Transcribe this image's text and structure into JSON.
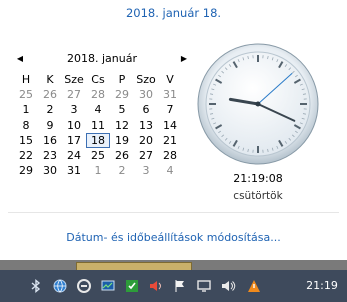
{
  "header": {
    "full_date": "2018. január 18."
  },
  "calendar": {
    "month_title": "2018. január",
    "prev_arrow": "◀",
    "next_arrow": "▶",
    "weekdays": [
      "H",
      "K",
      "Sze",
      "Cs",
      "P",
      "Szo",
      "V"
    ],
    "days": [
      {
        "d": "25",
        "other": true
      },
      {
        "d": "26",
        "other": true
      },
      {
        "d": "27",
        "other": true
      },
      {
        "d": "28",
        "other": true
      },
      {
        "d": "29",
        "other": true
      },
      {
        "d": "30",
        "other": true
      },
      {
        "d": "31",
        "other": true
      },
      {
        "d": "1"
      },
      {
        "d": "2"
      },
      {
        "d": "3"
      },
      {
        "d": "4"
      },
      {
        "d": "5"
      },
      {
        "d": "6"
      },
      {
        "d": "7"
      },
      {
        "d": "8"
      },
      {
        "d": "9"
      },
      {
        "d": "10"
      },
      {
        "d": "11"
      },
      {
        "d": "12"
      },
      {
        "d": "13"
      },
      {
        "d": "14"
      },
      {
        "d": "15"
      },
      {
        "d": "16"
      },
      {
        "d": "17"
      },
      {
        "d": "18",
        "today": true
      },
      {
        "d": "19"
      },
      {
        "d": "20"
      },
      {
        "d": "21"
      },
      {
        "d": "22"
      },
      {
        "d": "23"
      },
      {
        "d": "24"
      },
      {
        "d": "25"
      },
      {
        "d": "26"
      },
      {
        "d": "27"
      },
      {
        "d": "28"
      },
      {
        "d": "29"
      },
      {
        "d": "30"
      },
      {
        "d": "31"
      },
      {
        "d": "1",
        "other": true
      },
      {
        "d": "2",
        "other": true
      },
      {
        "d": "3",
        "other": true
      },
      {
        "d": "4",
        "other": true
      }
    ]
  },
  "clock": {
    "digital_time": "21:19:08",
    "weekday": "csütörtök",
    "hour": 21,
    "minute": 19,
    "second": 8
  },
  "settings_link": "Dátum- és időbeállítások módosítása...",
  "taskbar": {
    "time": "21:19",
    "tray_icons": [
      "bluetooth-icon",
      "network-globe-icon",
      "sync-icon",
      "task-manager-icon",
      "shield-icon",
      "volume-icon",
      "flag-icon",
      "network-monitor-icon",
      "speaker-icon",
      "action-center-icon"
    ]
  },
  "colors": {
    "accent": "#1f63b3",
    "taskbar": "#3e4a5c"
  }
}
